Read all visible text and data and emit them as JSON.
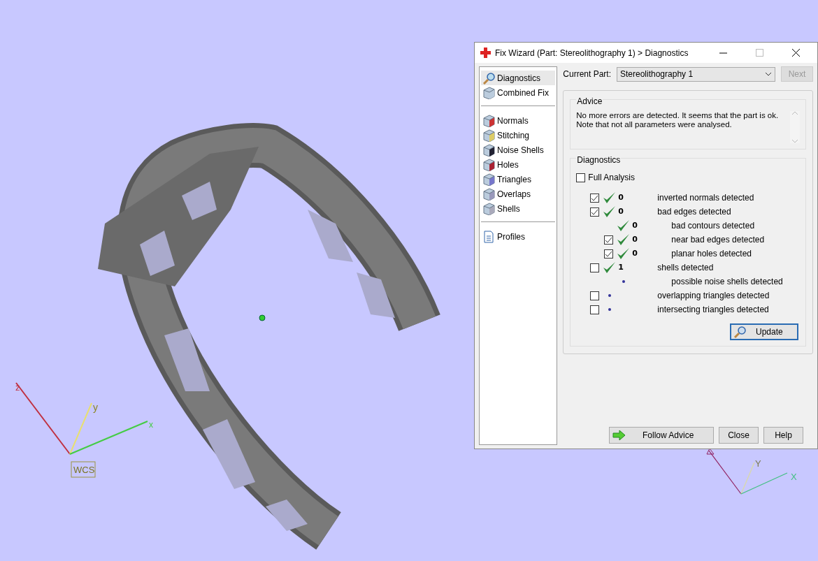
{
  "viewport": {
    "axes_left": {
      "z": "z",
      "y": "y",
      "x": "x",
      "frame": "WCS"
    },
    "axes_right": {
      "y": "Y",
      "x": "X"
    }
  },
  "dialog": {
    "title": "Fix Wizard (Part: Stereolithography 1) > Diagnostics",
    "sidebar": {
      "groups": [
        [
          {
            "label": "Diagnostics",
            "selected": true
          },
          {
            "label": "Combined Fix",
            "selected": false
          }
        ],
        [
          {
            "label": "Normals",
            "selected": false
          },
          {
            "label": "Stitching",
            "selected": false
          },
          {
            "label": "Noise Shells",
            "selected": false
          },
          {
            "label": "Holes",
            "selected": false
          },
          {
            "label": "Triangles",
            "selected": false
          },
          {
            "label": "Overlaps",
            "selected": false
          },
          {
            "label": "Shells",
            "selected": false
          }
        ],
        [
          {
            "label": "Profiles",
            "selected": false
          }
        ]
      ]
    },
    "current_part": {
      "label": "Current Part:",
      "value": "Stereolithography 1"
    },
    "next_button": {
      "label": "Next",
      "disabled": true
    },
    "advice": {
      "title": "Advice",
      "text": "No more errors are detected. It seems that the part is ok.\nNote that not all parameters were analysed."
    },
    "diagnostics": {
      "title": "Diagnostics",
      "full_analysis": {
        "label": "Full Analysis",
        "checked": false
      },
      "rows": [
        {
          "kind": "check",
          "checked": true,
          "passed": true,
          "count": "0",
          "label": "inverted normals detected"
        },
        {
          "kind": "check",
          "checked": true,
          "passed": true,
          "count": "0",
          "label": "bad edges detected",
          "children": [
            {
              "kind": "plain",
              "passed": true,
              "count": "0",
              "label": "bad contours detected"
            },
            {
              "kind": "check",
              "checked": true,
              "passed": true,
              "count": "0",
              "label": "near bad edges detected"
            },
            {
              "kind": "check",
              "checked": true,
              "passed": true,
              "count": "0",
              "label": "planar holes detected"
            }
          ]
        },
        {
          "kind": "check",
          "checked": false,
          "passed": true,
          "count": "1",
          "label": "shells detected",
          "children": [
            {
              "kind": "plain",
              "passed": false,
              "label": "possible noise shells detected"
            }
          ]
        },
        {
          "kind": "check",
          "checked": false,
          "passed": false,
          "label": "overlapping triangles detected"
        },
        {
          "kind": "check",
          "checked": false,
          "passed": false,
          "label": "intersecting triangles detected"
        }
      ],
      "update_button": "Update"
    },
    "buttons": {
      "follow_advice": "Follow Advice",
      "close": "Close",
      "help": "Help"
    }
  }
}
